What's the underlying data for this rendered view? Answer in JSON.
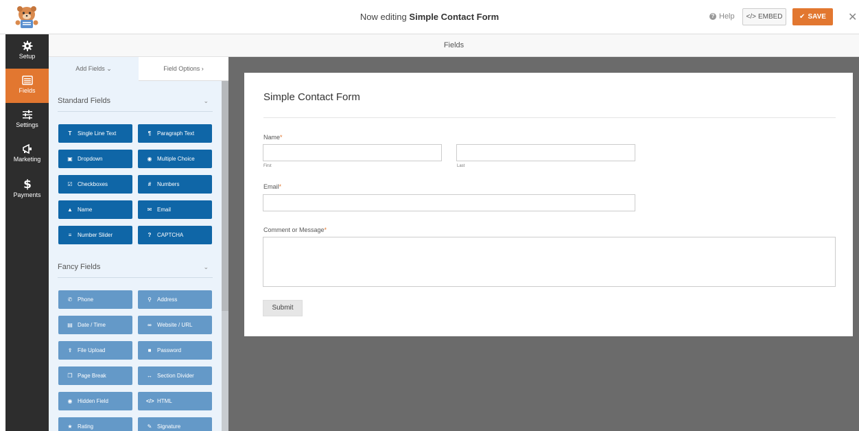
{
  "header": {
    "title_prefix": "Now editing",
    "form_name": "Simple Contact Form",
    "help_label": "Help",
    "embed_label": "EMBED",
    "save_label": "SAVE"
  },
  "nav": [
    {
      "label": "Setup",
      "icon": "gear-icon"
    },
    {
      "label": "Fields",
      "icon": "fields-icon"
    },
    {
      "label": "Settings",
      "icon": "sliders-icon"
    },
    {
      "label": "Marketing",
      "icon": "megaphone-icon"
    },
    {
      "label": "Payments",
      "icon": "dollar-icon"
    }
  ],
  "fields_strip": "Fields",
  "tabs": {
    "add_fields": "Add Fields",
    "field_options": "Field Options"
  },
  "standard_fields": {
    "heading": "Standard Fields",
    "items": [
      {
        "label": "Single Line Text",
        "icon": "text-icon"
      },
      {
        "label": "Paragraph Text",
        "icon": "paragraph-icon"
      },
      {
        "label": "Dropdown",
        "icon": "dropdown-icon"
      },
      {
        "label": "Multiple Choice",
        "icon": "radio-icon"
      },
      {
        "label": "Checkboxes",
        "icon": "checkbox-icon"
      },
      {
        "label": "Numbers",
        "icon": "hash-icon"
      },
      {
        "label": "Name",
        "icon": "user-icon"
      },
      {
        "label": "Email",
        "icon": "envelope-icon"
      },
      {
        "label": "Number Slider",
        "icon": "slider-icon"
      },
      {
        "label": "CAPTCHA",
        "icon": "question-icon"
      }
    ]
  },
  "fancy_fields": {
    "heading": "Fancy Fields",
    "items": [
      {
        "label": "Phone",
        "icon": "phone-icon"
      },
      {
        "label": "Address",
        "icon": "map-pin-icon"
      },
      {
        "label": "Date / Time",
        "icon": "calendar-icon"
      },
      {
        "label": "Website / URL",
        "icon": "link-icon"
      },
      {
        "label": "File Upload",
        "icon": "upload-icon"
      },
      {
        "label": "Password",
        "icon": "lock-icon"
      },
      {
        "label": "Page Break",
        "icon": "copy-icon"
      },
      {
        "label": "Section Divider",
        "icon": "divider-icon"
      },
      {
        "label": "Hidden Field",
        "icon": "eye-icon"
      },
      {
        "label": "HTML",
        "icon": "code-icon"
      },
      {
        "label": "Rating",
        "icon": "star-icon"
      },
      {
        "label": "Signature",
        "icon": "pen-icon"
      }
    ]
  },
  "form": {
    "title": "Simple Contact Form",
    "name_label": "Name",
    "first_label": "First",
    "last_label": "Last",
    "email_label": "Email",
    "message_label": "Comment or Message",
    "required_mark": "*",
    "submit_label": "Submit"
  },
  "colors": {
    "accent": "#e27730",
    "nav_bg": "#2d2d2d",
    "standard_button": "#0f66a7",
    "fancy_button": "#6499c8",
    "panel_bg": "#ebf3fb",
    "canvas_bg": "#6b6b6b"
  }
}
